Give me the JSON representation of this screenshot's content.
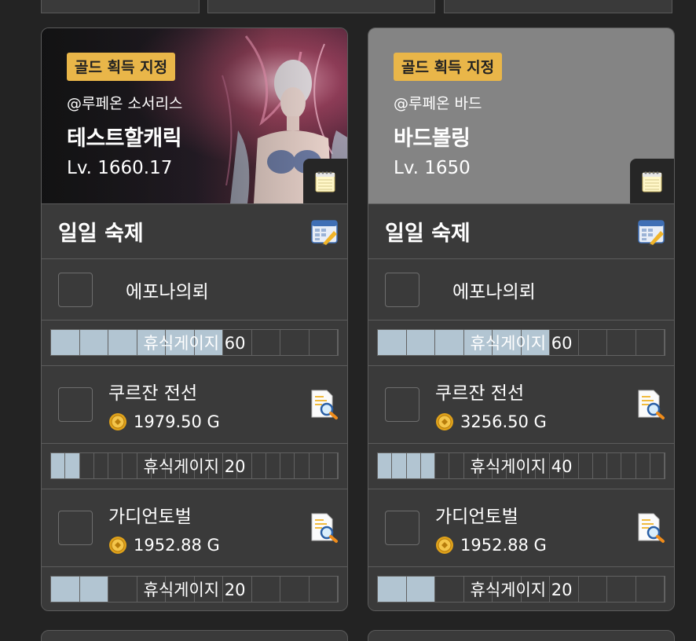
{
  "cards": [
    {
      "tag": "골드 획득 지정",
      "server": "@루페온 소서리스",
      "name": "테스트할캐릭",
      "level": "Lv. 1660.17",
      "section_title": "일일 숙제",
      "tasks": [
        {
          "name": "에포나의뢰",
          "gauge": {
            "label": "휴식게이지 60",
            "value": 60,
            "max": 100
          }
        },
        {
          "name": "쿠르잔 전선",
          "gold": "1979.50 G",
          "gauge": {
            "label": "휴식게이지 20",
            "value": 20,
            "max": 200
          }
        },
        {
          "name": "가디언토벌",
          "gold": "1952.88 G",
          "gauge": {
            "label": "휴식게이지 20",
            "value": 20,
            "max": 100
          }
        }
      ]
    },
    {
      "tag": "골드 획득 지정",
      "server": "@루페온 바드",
      "name": "바드볼링",
      "level": "Lv. 1650",
      "section_title": "일일 숙제",
      "tasks": [
        {
          "name": "에포나의뢰",
          "gauge": {
            "label": "휴식게이지 60",
            "value": 60,
            "max": 100
          }
        },
        {
          "name": "쿠르잔 전선",
          "gold": "3256.50 G",
          "gauge": {
            "label": "휴식게이지 40",
            "value": 40,
            "max": 200
          }
        },
        {
          "name": "가디언토벌",
          "gold": "1952.88 G",
          "gauge": {
            "label": "휴식게이지 20",
            "value": 20,
            "max": 100
          }
        }
      ]
    }
  ],
  "colors": {
    "gold_tag": "#e9b649",
    "gauge_fill": "#b2c5d2",
    "card_bg": "#3a3a3a",
    "page_bg": "#232323",
    "hero_gray": "#848484"
  },
  "icons": {
    "memo": "notepad-icon",
    "schedule": "schedule-edit-icon",
    "search": "document-search-icon",
    "coin": "gold-coin-icon"
  }
}
